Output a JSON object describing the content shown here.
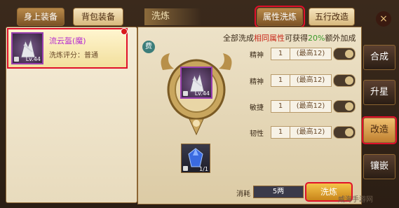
{
  "tabs": {
    "equipped": "身上装备",
    "bag": "背包装备",
    "refine_header": "洗炼",
    "attr_refine": "属性洗炼",
    "five_elements": "五行改造"
  },
  "item": {
    "name": "流云盔(魔)",
    "score_label": "洗炼评分：",
    "score_value": "普通",
    "level": "Lv.44"
  },
  "info": {
    "prefix": "全部洗成",
    "highlight": "相同属性",
    "middle": "可获得",
    "percent": "20%",
    "suffix": "额外加成"
  },
  "badge": "费",
  "attributes": [
    {
      "label": "精神",
      "value": "1",
      "max": "(最高12)"
    },
    {
      "label": "精神",
      "value": "1",
      "max": "(最高12)"
    },
    {
      "label": "敏捷",
      "value": "1",
      "max": "(最高12)"
    },
    {
      "label": "韧性",
      "value": "1",
      "max": "(最高12)"
    }
  ],
  "gem": {
    "count": "1/1"
  },
  "cost": {
    "label": "消耗",
    "value": "5两"
  },
  "refine_button": "洗炼",
  "side_tabs": [
    "合成",
    "升星",
    "改造",
    "镶嵌"
  ],
  "close": "×",
  "watermark": "威海手游网",
  "colors": {
    "highlight_red": "#e0102a",
    "accent_gold": "#c8841a",
    "purple_name": "#b52ad0"
  }
}
